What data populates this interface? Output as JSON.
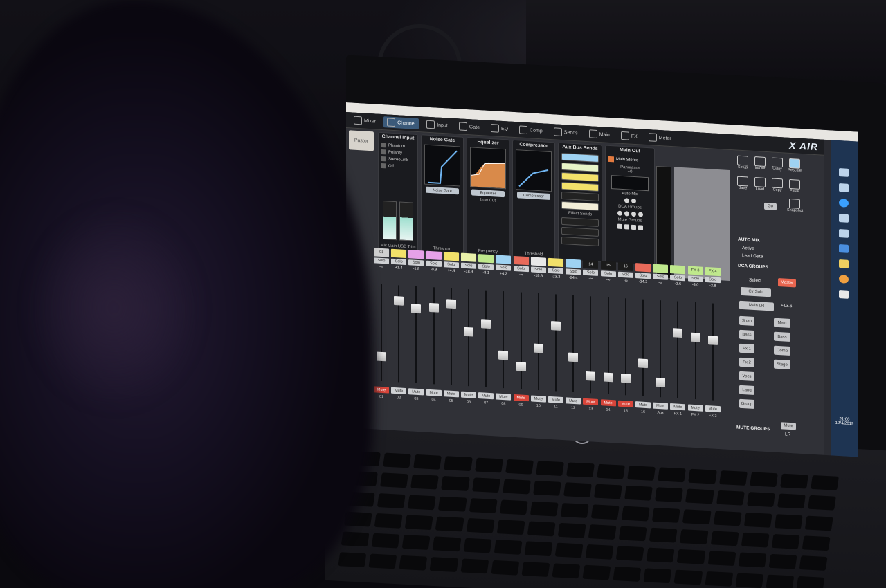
{
  "toolbar_tabs": [
    "Mixer",
    "Channel",
    "Input",
    "Gate",
    "EQ",
    "Comp",
    "Sends",
    "Main",
    "FX",
    "Meter"
  ],
  "brand": "X AIR",
  "scene_name": "Pastor",
  "panels": {
    "channel_input": {
      "title": "Channel Input",
      "options": [
        "Phantom",
        "Polarity",
        "StereoLink",
        "Off"
      ],
      "footer": "Mic Gain  USB Trim"
    },
    "noise_gate": {
      "title": "Noise Gate",
      "button": "Noise Gate",
      "footer": "Threshold"
    },
    "equalizer": {
      "title": "Equalizer",
      "button": "Equalizer",
      "lowcut": "Low Cut",
      "footer": "Frequency"
    },
    "compressor": {
      "title": "Compressor",
      "button": "Compressor",
      "footer": "Threshold"
    },
    "aux_sends": {
      "title": "Aux Bus Sends",
      "fx_title": "Effect Sends"
    },
    "main_out": {
      "title": "Main Out",
      "main_stereo": "Main Stereo",
      "panorama": "Panorama",
      "pan_value": "+0",
      "automix": "Auto Mix",
      "dca": "DCA Groups",
      "mute": "Mute Groups"
    }
  },
  "channels": [
    {
      "name": "01",
      "color": "#cfcfcf",
      "val": "-∞",
      "pos": 0.75,
      "mute": true,
      "num": "01"
    },
    {
      "name": "",
      "color": "#f2e16a",
      "val": "+1.4",
      "pos": 0.12,
      "mute": false,
      "num": "02"
    },
    {
      "name": "",
      "color": "#e6a1e8",
      "val": "-1.8",
      "pos": 0.2,
      "mute": false,
      "num": "03"
    },
    {
      "name": "",
      "color": "#e6a1e8",
      "val": "-0.9",
      "pos": 0.18,
      "mute": false,
      "num": "04"
    },
    {
      "name": "",
      "color": "#f2e16a",
      "val": "+4.4",
      "pos": 0.12,
      "mute": false,
      "num": "05"
    },
    {
      "name": "",
      "color": "#e8f0a8",
      "val": "-18.3",
      "pos": 0.42,
      "mute": false,
      "num": "06"
    },
    {
      "name": "",
      "color": "#bfe88c",
      "val": "-8.1",
      "pos": 0.32,
      "mute": false,
      "num": "07"
    },
    {
      "name": "",
      "color": "#9ed2f2",
      "val": "+4.2",
      "pos": 0.66,
      "mute": false,
      "num": "08"
    },
    {
      "name": "",
      "color": "#e86a5a",
      "val": "-∞",
      "pos": 0.78,
      "mute": true,
      "num": "09"
    },
    {
      "name": "",
      "color": "#e8e8e8",
      "val": "-18.6",
      "pos": 0.56,
      "mute": false,
      "num": "10"
    },
    {
      "name": "",
      "color": "#f2e16a",
      "val": "-23.3",
      "pos": 0.3,
      "mute": false,
      "num": "11"
    },
    {
      "name": "",
      "color": "#9ed2f2",
      "val": "-24.4",
      "pos": 0.64,
      "mute": false,
      "num": "12"
    },
    {
      "name": "14",
      "color": "#1b1b1b",
      "val": "-∞",
      "pos": 0.84,
      "mute": true,
      "num": "13"
    },
    {
      "name": "15",
      "color": "#1b1b1b",
      "val": "-∞",
      "pos": 0.84,
      "mute": true,
      "num": "14"
    },
    {
      "name": "16",
      "color": "#1b1b1b",
      "val": "-∞",
      "pos": 0.84,
      "mute": true,
      "num": "15"
    },
    {
      "name": "",
      "color": "#e86a5a",
      "val": "-24.3",
      "pos": 0.66,
      "mute": false,
      "num": "16"
    },
    {
      "name": "",
      "color": "#bfe88c",
      "val": "-∞",
      "pos": 0.86,
      "mute": false,
      "num": "Aux"
    },
    {
      "name": "",
      "color": "#bfe88c",
      "val": "-2.6",
      "pos": 0.3,
      "mute": false,
      "num": "FX 1"
    },
    {
      "name": "FX 3",
      "color": "#bfe88c",
      "val": "-3.0",
      "pos": 0.34,
      "mute": false,
      "num": "FX 2"
    },
    {
      "name": "FX 4",
      "color": "#bfe88c",
      "val": "-3.8",
      "pos": 0.36,
      "mute": false,
      "num": "FX 3"
    }
  ],
  "buttons": {
    "solo": "Solo",
    "mute": "Mute"
  },
  "right": {
    "setup": "Setup",
    "inout": "In/Out",
    "utility": "Utility",
    "rescale": "Rescale",
    "save": "Save",
    "load": "Load",
    "copy": "Copy",
    "paste": "Paste",
    "snapshot": "Snapshot",
    "go": "Go",
    "auto_mix": "AUTO MIX",
    "active": "Active",
    "lead_gate": "Lead Gate",
    "dca_groups": "DCA GROUPS",
    "select": "Select",
    "master": "Master",
    "clr_solo": "Clr Solo",
    "main_lr": "Main LR",
    "main_val": "+13.5",
    "mute_groups": "MUTE GROUPS",
    "lr": "LR",
    "grid_left": [
      "Snap",
      "Bass",
      "Fx 1",
      "Fx 2",
      "Vocs",
      "Lang",
      "Group"
    ],
    "grid_right": [
      "Main",
      "Bass",
      "Comp",
      "Stage"
    ]
  },
  "clock": {
    "time": "21:00",
    "date": "12/4/2019"
  }
}
